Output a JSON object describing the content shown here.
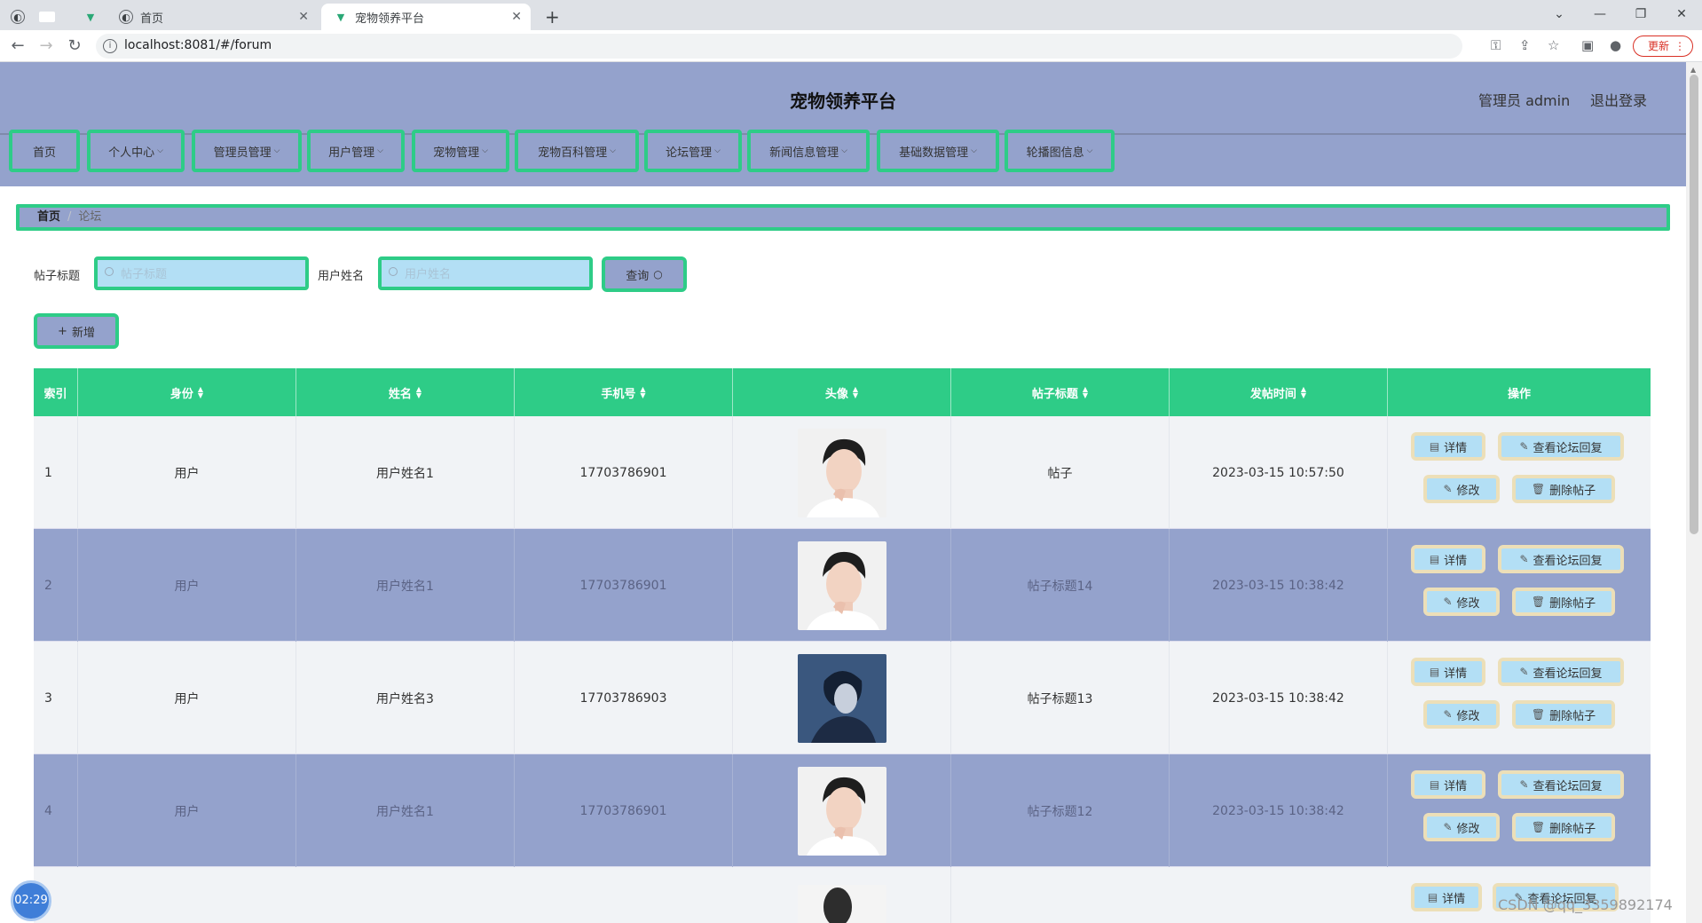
{
  "browser": {
    "tabs": [
      {
        "label": ""
      },
      {
        "label": ""
      },
      {
        "label": ""
      },
      {
        "label": "首页"
      },
      {
        "label": "宠物领养平台"
      }
    ],
    "url": "localhost:8081/#/forum",
    "update_label": "更新"
  },
  "header": {
    "title": "宠物领养平台",
    "user": "管理员 admin",
    "logout": "退出登录"
  },
  "menu": [
    {
      "label": "首页",
      "dropdown": false
    },
    {
      "label": "个人中心",
      "dropdown": true
    },
    {
      "label": "管理员管理",
      "dropdown": true
    },
    {
      "label": "用户管理",
      "dropdown": true
    },
    {
      "label": "宠物管理",
      "dropdown": true
    },
    {
      "label": "宠物百科管理",
      "dropdown": true
    },
    {
      "label": "论坛管理",
      "dropdown": true
    },
    {
      "label": "新闻信息管理",
      "dropdown": true
    },
    {
      "label": "基础数据管理",
      "dropdown": true
    },
    {
      "label": "轮播图信息",
      "dropdown": true
    }
  ],
  "breadcrumb": {
    "home": "首页",
    "sep": "/",
    "current": "论坛"
  },
  "search": {
    "title_label": "帖子标题",
    "title_placeholder": "帖子标题",
    "user_label": "用户姓名",
    "user_placeholder": "用户姓名",
    "query_label": "查询"
  },
  "add_label": "新增",
  "table": {
    "columns": [
      "索引",
      "身份",
      "姓名",
      "手机号",
      "头像",
      "帖子标题",
      "发帖时间",
      "操作"
    ],
    "rows": [
      {
        "index": "1",
        "role": "用户",
        "name": "用户姓名1",
        "phone": "17703786901",
        "title": "帖子",
        "time": "2023-03-15 10:57:50",
        "avatar": "face-a"
      },
      {
        "index": "2",
        "role": "用户",
        "name": "用户姓名1",
        "phone": "17703786901",
        "title": "帖子标题14",
        "time": "2023-03-15 10:38:42",
        "avatar": "face-a"
      },
      {
        "index": "3",
        "role": "用户",
        "name": "用户姓名3",
        "phone": "17703786903",
        "title": "帖子标题13",
        "time": "2023-03-15 10:38:42",
        "avatar": "face-b"
      },
      {
        "index": "4",
        "role": "用户",
        "name": "用户姓名1",
        "phone": "17703786901",
        "title": "帖子标题12",
        "time": "2023-03-15 10:38:42",
        "avatar": "face-a"
      }
    ],
    "actions": {
      "detail": "详情",
      "replies": "查看论坛回复",
      "edit": "修改",
      "delete": "删除帖子"
    }
  },
  "clock": "02:29",
  "watermark": "CSDN @qq_3359892174",
  "colors": {
    "accent_green": "#2ecc87",
    "nav_bg": "#94a2cc",
    "button_bg": "#b3dff5",
    "button_border": "#ecdfb8"
  }
}
